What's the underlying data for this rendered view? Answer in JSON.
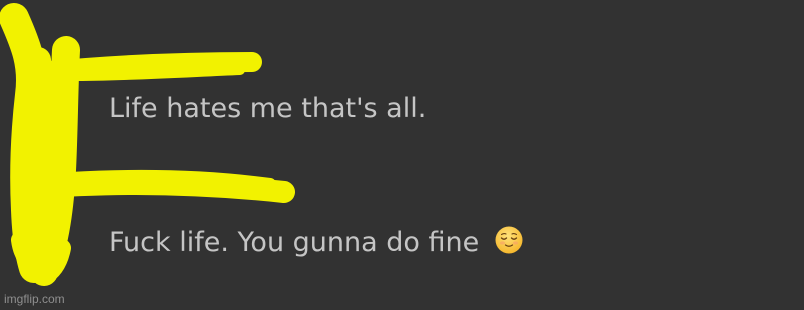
{
  "messages": [
    {
      "text": "Life hates me that's all."
    },
    {
      "text": "Fuck life. You gunna do fine",
      "emoji": "relieved-face-icon"
    }
  ],
  "watermark": "imgflip.com",
  "colors": {
    "background": "#323232",
    "text": "#c5c5c5",
    "scribble": "#f2f200",
    "watermark": "#8f8f8f"
  }
}
